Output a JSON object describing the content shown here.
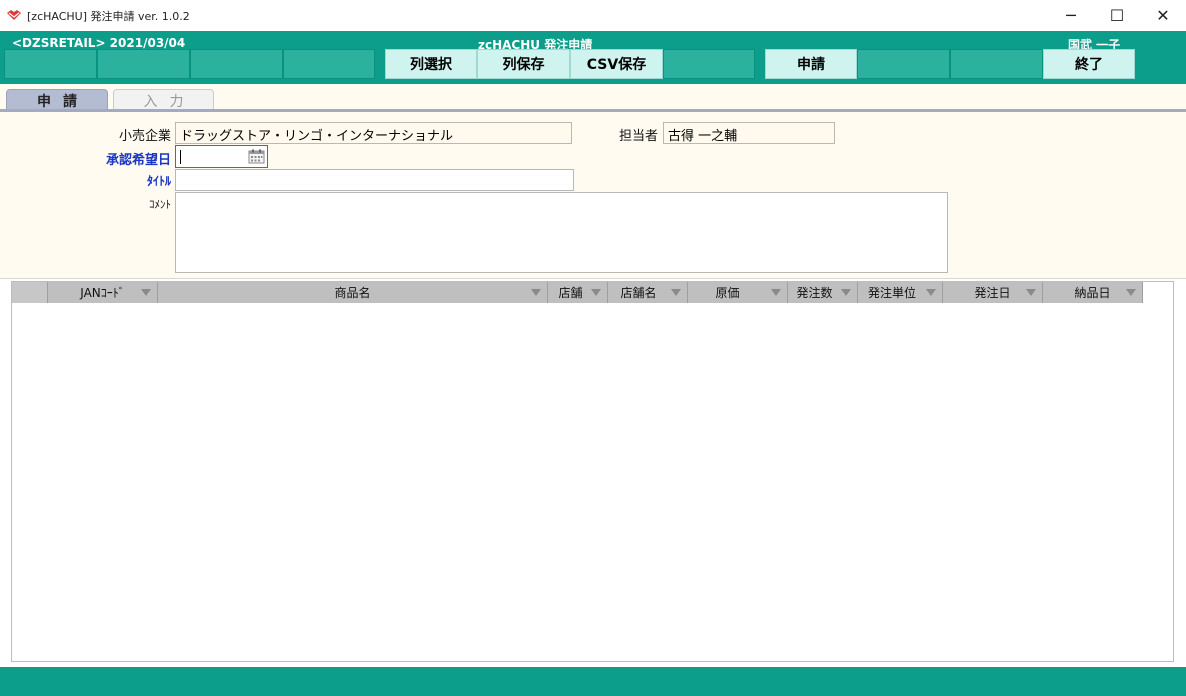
{
  "window": {
    "title": "[zcHACHU] 発注申請 ver. 1.0.2",
    "min_glyph": "─",
    "max_glyph": "☐",
    "close_glyph": "✕"
  },
  "header": {
    "left_info": "<DZSRETAIL>  2021/03/04",
    "center_title": "zcHACHU  発注申請",
    "user": "国武  一子"
  },
  "toolbar": {
    "col_select": "列選択",
    "col_save": "列保存",
    "csv_save": "CSV保存",
    "apply": "申請",
    "exit": "終了"
  },
  "tabs": [
    {
      "label": "申請",
      "active": true
    },
    {
      "label": "入力",
      "active": false
    }
  ],
  "form": {
    "retailer_label": "小売企業",
    "retailer_value": "ドラッグストア・リンゴ・インターナショナル",
    "staff_label": "担当者",
    "staff_value": "古得  一之輔",
    "date_label": "承認希望日",
    "date_value": "",
    "title_label": "ﾀｲﾄﾙ",
    "title_value": "",
    "comment_label": "ｺﾒﾝﾄ",
    "comment_value": ""
  },
  "grid": {
    "columns": [
      "JANｺｰﾄﾞ",
      "商品名",
      "店舗",
      "店舗名",
      "原価",
      "発注数",
      "発注単位",
      "発注日",
      "納品日"
    ]
  },
  "colors": {
    "accent": "#0c9e8a",
    "label_blue": "#1b35c4"
  }
}
